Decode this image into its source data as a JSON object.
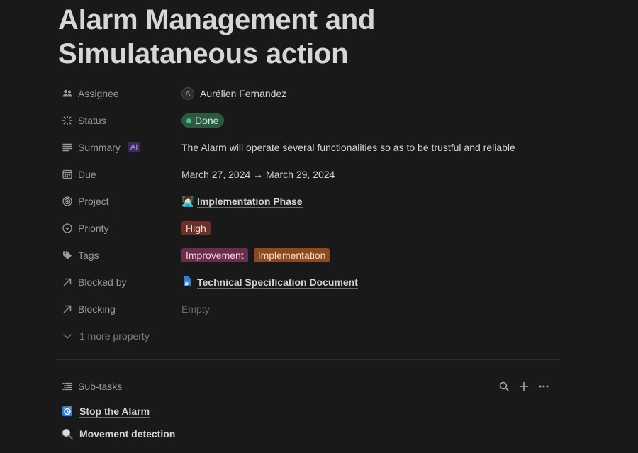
{
  "page": {
    "title_line1": "Alarm Management and",
    "title_line2": "Simulataneous action"
  },
  "properties": {
    "assignee": {
      "label": "Assignee",
      "avatar_letter": "A",
      "value": "Aurélien Fernandez"
    },
    "status": {
      "label": "Status",
      "value": "Done"
    },
    "summary": {
      "label": "Summary",
      "badge": "AI",
      "value": "The Alarm will operate several functionalities so as to be trustful and reliable"
    },
    "due": {
      "label": "Due",
      "value": "March 27, 2024 → March 29, 2024"
    },
    "project": {
      "label": "Project",
      "icon": "👩🏻‍💻",
      "value": "Implementation Phase"
    },
    "priority": {
      "label": "Priority",
      "value": "High"
    },
    "tags": {
      "label": "Tags",
      "values": [
        "Improvement",
        "Implementation"
      ]
    },
    "blocked_by": {
      "label": "Blocked by",
      "value": "Technical Specification Document"
    },
    "blocking": {
      "label": "Blocking",
      "value": "Empty"
    },
    "more": "1 more property"
  },
  "subtasks": {
    "label": "Sub-tasks",
    "items": [
      {
        "label": "Stop the Alarm",
        "icon": "⏰"
      },
      {
        "label": "Movement detection",
        "icon": "🔍"
      }
    ]
  },
  "colors": {
    "background": "#191919",
    "status_done": "#2b5a40",
    "priority_high": "#6b2f2a",
    "tag_improvement": "#6a2d4a",
    "tag_implementation": "#8a4a1f"
  }
}
